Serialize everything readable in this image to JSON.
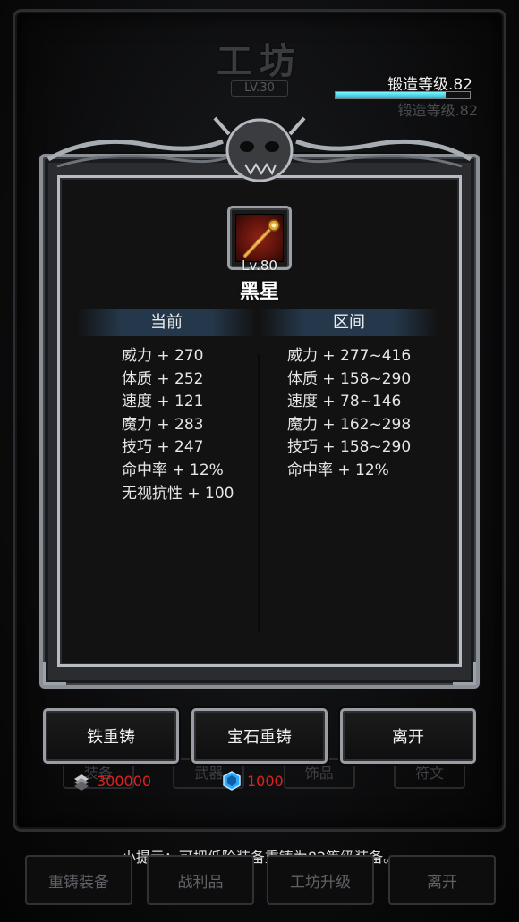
{
  "background": {
    "title": "工坊",
    "level": "LV.30",
    "forge_level_ghost": "锻造等级.82",
    "tabs": [
      "装备",
      "武器",
      "饰品",
      "符文"
    ]
  },
  "forge": {
    "label": "锻造等级.82",
    "progress": 0.82,
    "accent": "#1fb7d0"
  },
  "item": {
    "level": "Lv.80",
    "name": "黑星",
    "icon": "golden-staff-icon",
    "bg_color": "#8e2316"
  },
  "columns": {
    "current_header": "当前",
    "range_header": "区间"
  },
  "current_stats": [
    "威力 + 270",
    "体质 + 252",
    "速度 + 121",
    "魔力 + 283",
    "技巧 + 247",
    "命中率 + 12%",
    "无视抗性 + 100"
  ],
  "range_stats": [
    "威力 + 277~416",
    "体质 + 158~290",
    "速度 + 78~146",
    "魔力 + 162~298",
    "技巧 + 158~290",
    "命中率 + 12%"
  ],
  "buttons": {
    "iron_recast": "铁重铸",
    "gem_recast": "宝石重铸",
    "leave": "离开"
  },
  "currency": {
    "iron_amount": "300000",
    "iron_color": "#e02020",
    "gem_amount": "1000",
    "gem_color": "#e02020",
    "gem_icon_color": "#2ba8ff"
  },
  "tip": "小提示：可把低阶装备重铸为82等级装备。",
  "bottom_nav": {
    "recast": "重铸装备",
    "loot": "战利品",
    "upgrade": "工坊升级",
    "leave": "离开"
  }
}
